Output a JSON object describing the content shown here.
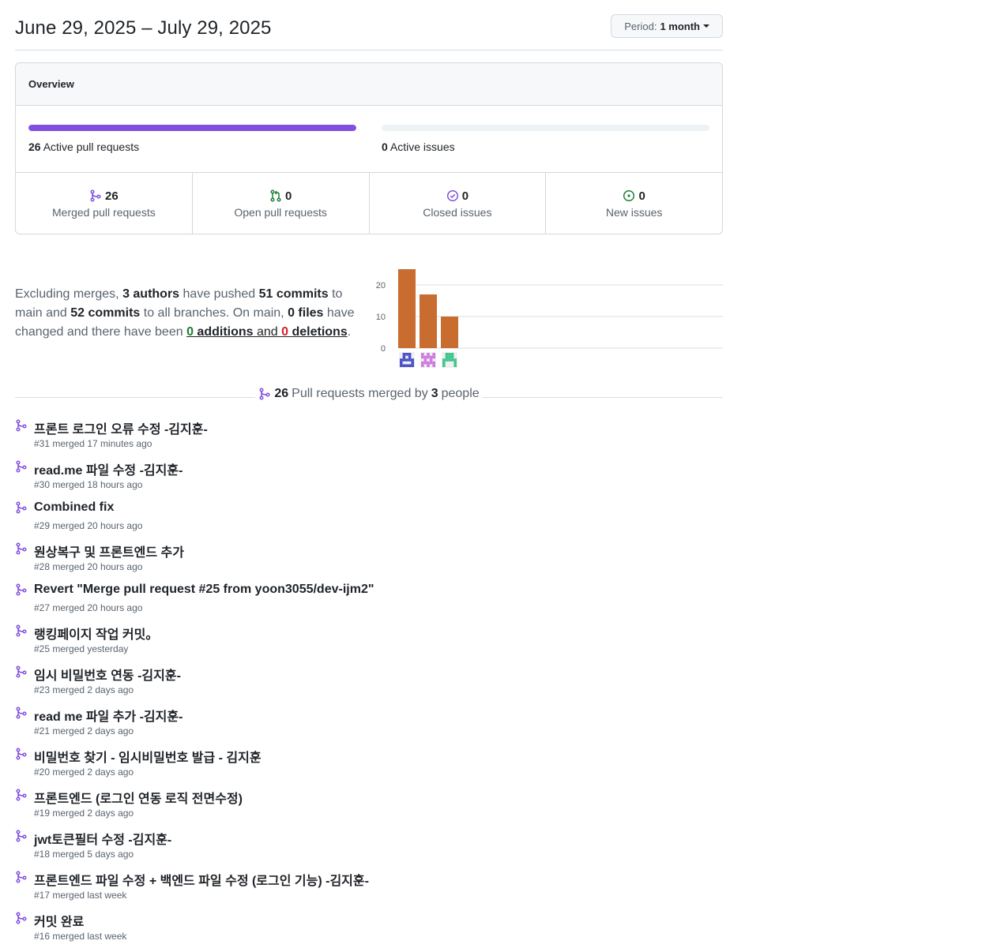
{
  "header": {
    "date_range": "June 29, 2025 – July 29, 2025",
    "period_label": "Period:",
    "period_value": "1 month"
  },
  "overview": {
    "title": "Overview",
    "pull_requests_bar": {
      "count": "26",
      "label": "Active pull requests",
      "fill_fraction": 1.0,
      "color": "#8250df"
    },
    "issues_bar": {
      "count": "0",
      "label": "Active issues",
      "fill_fraction": 0.0
    },
    "stats": [
      {
        "icon": "merged-pr-icon",
        "value": "26",
        "label": "Merged pull requests",
        "color": "#8250df"
      },
      {
        "icon": "open-pr-icon",
        "value": "0",
        "label": "Open pull requests",
        "color": "#1a7f37"
      },
      {
        "icon": "closed-issue-icon",
        "value": "0",
        "label": "Closed issues",
        "color": "#8250df"
      },
      {
        "icon": "new-issue-icon",
        "value": "0",
        "label": "New issues",
        "color": "#1a7f37"
      }
    ]
  },
  "summary": {
    "p1": "Excluding merges, ",
    "authors": "3 authors",
    "p2": " have pushed ",
    "commits_main": "51 commits",
    "p3": " to main and ",
    "commits_all": "52 commits",
    "p4": " to all branches. On main, ",
    "files": "0 files",
    "p5": " have changed and there have been ",
    "additions_num": "0",
    "additions_word": " additions",
    "and": " and ",
    "deletions_num": "0",
    "deletions_word": " deletions",
    "end": "."
  },
  "chart_data": {
    "type": "bar",
    "categories": [
      "author-1",
      "author-2",
      "author-3"
    ],
    "values": [
      25,
      17,
      10
    ],
    "ylim": [
      0,
      25
    ],
    "yticks": [
      "0",
      "10",
      "20"
    ],
    "color": "#c96c30",
    "grid": true,
    "avatar_colors": [
      "#4a50c8",
      "#d07ae0",
      "#3fc68e"
    ]
  },
  "divider": {
    "count": "26",
    "text1": " Pull requests merged by ",
    "people": "3",
    "text2": " people"
  },
  "pull_requests": [
    {
      "title": "프론트 로그인 오류 수정 -김지훈-",
      "meta": "#31 merged 17 minutes ago"
    },
    {
      "title": "read.me 파일 수정 -김지훈-",
      "meta": "#30 merged 18 hours ago"
    },
    {
      "title": "Combined fix",
      "meta": "#29 merged 20 hours ago"
    },
    {
      "title": "원상복구 및 프론트엔드 추가",
      "meta": "#28 merged 20 hours ago"
    },
    {
      "title": "Revert \"Merge pull request #25 from yoon3055/dev-ijm2\"",
      "meta": "#27 merged 20 hours ago"
    },
    {
      "title": "랭킹페이지 작업 커밋。",
      "meta": "#25 merged yesterday"
    },
    {
      "title": "임시 비밀번호 연동 -김지훈-",
      "meta": "#23 merged 2 days ago"
    },
    {
      "title": "read me 파일 추가 -김지훈-",
      "meta": "#21 merged 2 days ago"
    },
    {
      "title": "비밀번호 찾기 - 임시비밀번호 발급 - 김지훈",
      "meta": "#20 merged 2 days ago"
    },
    {
      "title": "프론트엔드 (로그인 연동 로직 전면수정)",
      "meta": "#19 merged 2 days ago"
    },
    {
      "title": "jwt토큰필터 수정 -김지훈-",
      "meta": "#18 merged 5 days ago"
    },
    {
      "title": "프론트엔드 파일 수정 + 백엔드 파일 수정 (로그인 기능) -김지훈-",
      "meta": "#17 merged last week"
    },
    {
      "title": "커밋 완료",
      "meta": "#16 merged last week"
    }
  ]
}
